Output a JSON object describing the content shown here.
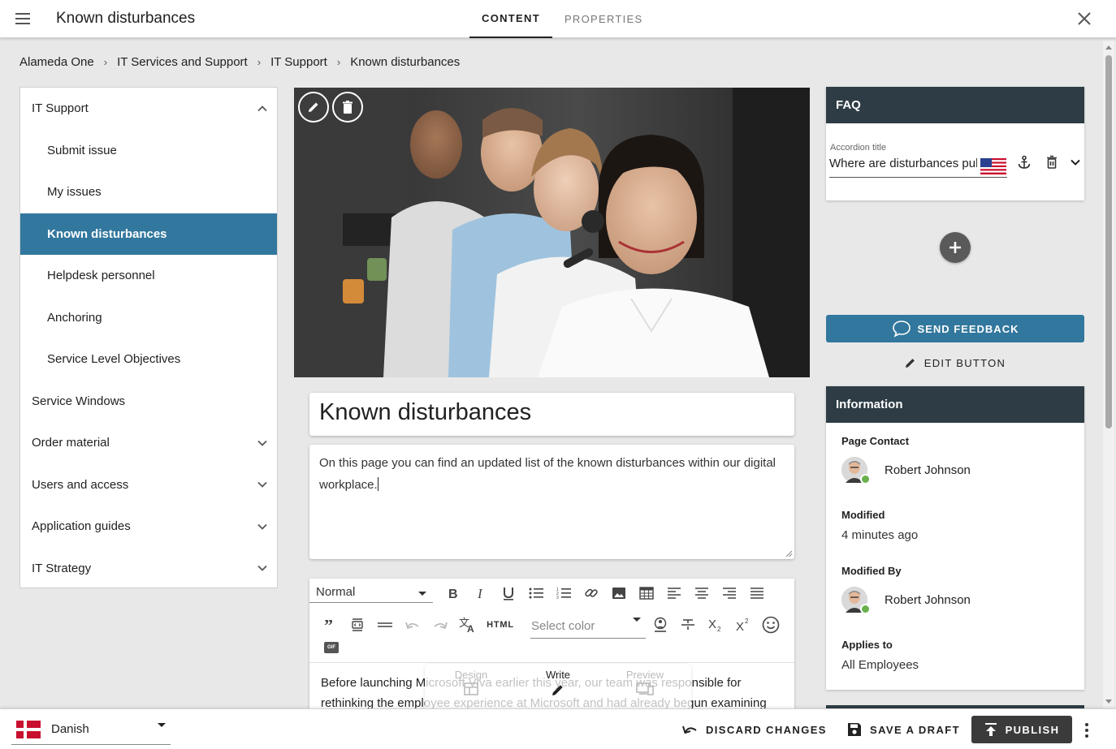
{
  "header": {
    "title": "Known disturbances",
    "tabs": [
      {
        "label": "CONTENT",
        "active": true
      },
      {
        "label": "PROPERTIES",
        "active": false
      }
    ]
  },
  "breadcrumb": [
    "Alameda One",
    "IT Services and Support",
    "IT Support",
    "Known disturbances"
  ],
  "sidebar": {
    "items": [
      {
        "label": "IT Support",
        "level": "top",
        "expanded": true
      },
      {
        "label": "Submit issue",
        "level": "sub"
      },
      {
        "label": "My issues",
        "level": "sub"
      },
      {
        "label": "Known disturbances",
        "level": "sub",
        "active": true
      },
      {
        "label": "Helpdesk personnel",
        "level": "sub"
      },
      {
        "label": "Anchoring",
        "level": "sub"
      },
      {
        "label": "Service Level Objectives",
        "level": "sub"
      },
      {
        "label": "Service Windows",
        "level": "top"
      },
      {
        "label": "Order material",
        "level": "top",
        "expandable": true
      },
      {
        "label": "Users and access",
        "level": "top",
        "expandable": true
      },
      {
        "label": "Application guides",
        "level": "top",
        "expandable": true
      },
      {
        "label": "IT Strategy",
        "level": "top",
        "expandable": true
      }
    ]
  },
  "content": {
    "page_title": "Known disturbances",
    "intro": "On this page you can find an updated list of the known disturbances within our digital workplace.",
    "editor": {
      "paragraph_style": "Normal",
      "html_label": "HTML",
      "color_placeholder": "Select color",
      "gif_label": "GIF",
      "body_text": "Before launching Microsoft Viva earlier this year, our team was responsible for rethinking the employee experience at Microsoft and had already begun examining",
      "modes": [
        "Design",
        "Write",
        "Preview"
      ],
      "active_mode": "Write"
    }
  },
  "faq": {
    "title": "FAQ",
    "accordion_label": "Accordion title",
    "accordion_value": "Where are disturbances published?"
  },
  "actions": {
    "send_feedback": "SEND FEEDBACK",
    "edit_button": "EDIT BUTTON"
  },
  "information": {
    "title": "Information",
    "page_contact_label": "Page Contact",
    "page_contact": "Robert Johnson",
    "modified_label": "Modified",
    "modified": "4 minutes ago",
    "modified_by_label": "Modified By",
    "modified_by": "Robert Johnson",
    "applies_to_label": "Applies to",
    "applies_to": "All Employees"
  },
  "footer": {
    "language": "Danish",
    "discard": "DISCARD CHANGES",
    "save_draft": "SAVE A DRAFT",
    "publish": "PUBLISH"
  },
  "colors": {
    "accent": "#32779d",
    "card_header": "#2d3c45",
    "publish": "#3b3b3b"
  }
}
